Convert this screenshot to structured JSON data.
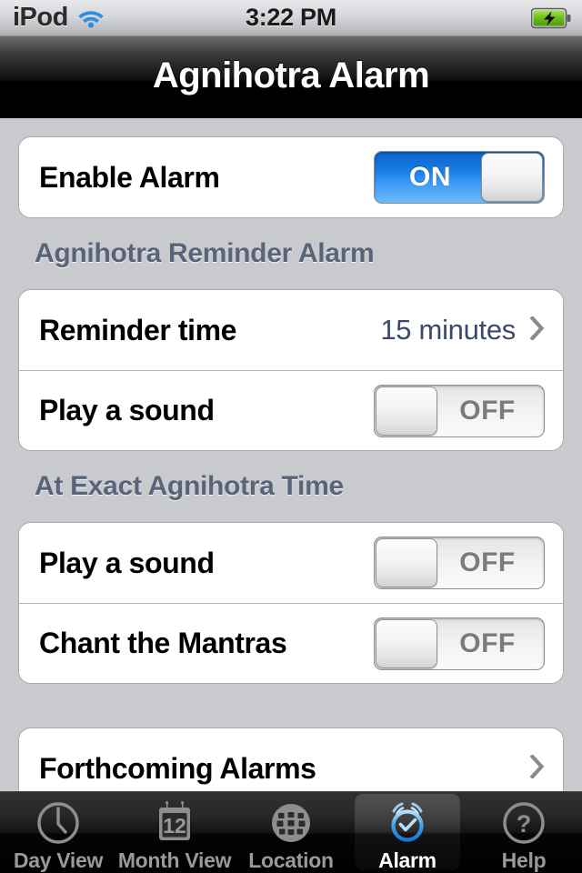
{
  "status_bar": {
    "carrier": "iPod",
    "wifi_icon": "wifi-icon",
    "time": "3:22 PM",
    "battery_icon": "battery-charging-icon",
    "battery_color": "#6ec21a"
  },
  "nav_bar": {
    "title": "Agnihotra Alarm"
  },
  "colors": {
    "background": "#c9cace",
    "card": "#ffffff",
    "section_header": "#59637a",
    "value_text": "#3b4a6b",
    "switch_on": "#1a7ee8",
    "switch_off_text": "#7b7b7e",
    "tab_selected": "#3faaf0"
  },
  "groups": [
    {
      "header": null,
      "rows": [
        {
          "label": "Enable Alarm",
          "control": "switch",
          "state": "on",
          "state_label": "ON",
          "name": "enable-alarm-switch"
        }
      ]
    },
    {
      "header": "Agnihotra Reminder Alarm",
      "rows": [
        {
          "label": "Reminder time",
          "control": "disclosure",
          "value": "15 minutes",
          "name": "reminder-time-row"
        },
        {
          "label": "Play a sound",
          "control": "switch",
          "state": "off",
          "state_label": "OFF",
          "name": "reminder-play-sound-switch"
        }
      ]
    },
    {
      "header": "At Exact Agnihotra Time",
      "rows": [
        {
          "label": "Play a sound",
          "control": "switch",
          "state": "off",
          "state_label": "OFF",
          "name": "exact-play-sound-switch"
        },
        {
          "label": "Chant the Mantras",
          "control": "switch",
          "state": "off",
          "state_label": "OFF",
          "name": "chant-mantras-switch"
        }
      ]
    },
    {
      "header": null,
      "rows": [
        {
          "label": "Forthcoming Alarms",
          "control": "disclosure",
          "value": "",
          "name": "forthcoming-alarms-row"
        }
      ]
    }
  ],
  "tab_bar": {
    "items": [
      {
        "label": "Day View",
        "icon": "clock-icon",
        "selected": false
      },
      {
        "label": "Month View",
        "icon": "calendar-icon",
        "selected": false,
        "calendar_day": "12"
      },
      {
        "label": "Location",
        "icon": "globe-icon",
        "selected": false
      },
      {
        "label": "Alarm",
        "icon": "alarm-clock-icon",
        "selected": true
      },
      {
        "label": "Help",
        "icon": "question-mark-icon",
        "selected": false
      }
    ]
  }
}
